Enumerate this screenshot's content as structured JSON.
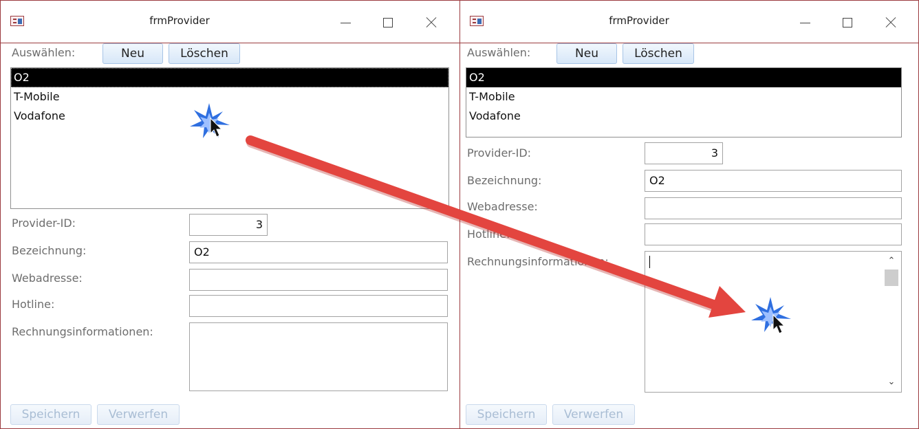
{
  "left_window": {
    "title": "frmProvider",
    "select_label": "Auswählen:",
    "new_button": "Neu",
    "delete_button": "Löschen",
    "list_items": [
      "O2",
      "T-Mobile",
      "Vodafone"
    ],
    "selected_item": "O2",
    "fields": {
      "provider_id_label": "Provider-ID:",
      "provider_id_value": "3",
      "name_label": "Bezeichnung:",
      "name_value": "O2",
      "web_label": "Webadresse:",
      "web_value": "",
      "hotline_label": "Hotline:",
      "hotline_value": "",
      "billing_label": "Rechnungsinformationen:",
      "billing_value": ""
    },
    "save_button": "Speichern",
    "discard_button": "Verwerfen"
  },
  "right_window": {
    "title": "frmProvider",
    "select_label": "Auswählen:",
    "new_button": "Neu",
    "delete_button": "Löschen",
    "list_items": [
      "O2",
      "T-Mobile",
      "Vodafone"
    ],
    "selected_item": "O2",
    "fields": {
      "provider_id_label": "Provider-ID:",
      "provider_id_value": "3",
      "name_label": "Bezeichnung:",
      "name_value": "O2",
      "web_label": "Webadresse:",
      "web_value": "",
      "hotline_label": "Hotline:",
      "hotline_value": "",
      "billing_label": "Rechnungsinformationen:",
      "billing_value": ""
    },
    "save_button": "Speichern",
    "discard_button": "Verwerfen"
  },
  "colors": {
    "window_border": "#9b3a3e",
    "button_face": "#d7e7f8",
    "arrow": "#e3453f",
    "click_burst": "#2f6fe0"
  },
  "icons": {
    "app": "form-icon",
    "minimize": "minimize-icon",
    "maximize": "maximize-icon",
    "close": "close-icon",
    "cursor": "mouse-pointer-icon",
    "click": "click-burst-icon",
    "arrow": "transition-arrow-icon"
  }
}
